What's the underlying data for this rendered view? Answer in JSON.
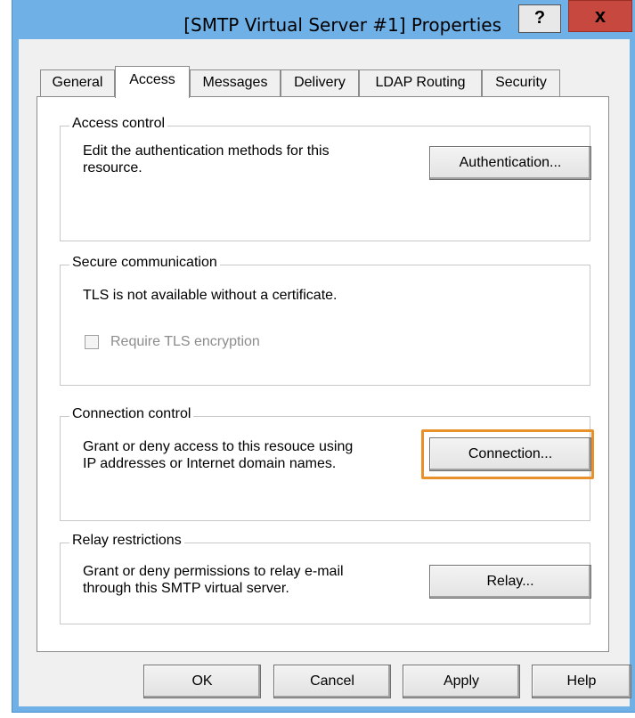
{
  "window": {
    "title": "[SMTP Virtual Server #1] Properties",
    "help_label": "?",
    "close_label": "x"
  },
  "tabs": [
    {
      "label": "General",
      "active": false
    },
    {
      "label": "Access",
      "active": true
    },
    {
      "label": "Messages",
      "active": false
    },
    {
      "label": "Delivery",
      "active": false
    },
    {
      "label": "LDAP Routing",
      "active": false
    },
    {
      "label": "Security",
      "active": false
    }
  ],
  "access_control": {
    "title": "Access control",
    "description_line1": "Edit the authentication methods for this",
    "description_line2": "resource.",
    "button": "Authentication..."
  },
  "secure_communication": {
    "title": "Secure communication",
    "description": "TLS is not available without a certificate.",
    "checkbox_label": "Require TLS encryption",
    "checkbox_checked": false,
    "checkbox_enabled": false
  },
  "connection_control": {
    "title": "Connection control",
    "description_line1": "Grant or deny access to this resouce using",
    "description_line2": "IP addresses or Internet domain names.",
    "button": "Connection..."
  },
  "relay_restrictions": {
    "title": "Relay restrictions",
    "description_line1": "Grant or deny permissions to relay e-mail",
    "description_line2": "through this SMTP virtual server.",
    "button": "Relay..."
  },
  "footer": {
    "ok": "OK",
    "cancel": "Cancel",
    "apply": "Apply",
    "help": "Help"
  },
  "colors": {
    "titlebar": "#6fb1e6",
    "close_button": "#c7483e",
    "focus_highlight": "#e8912b"
  }
}
